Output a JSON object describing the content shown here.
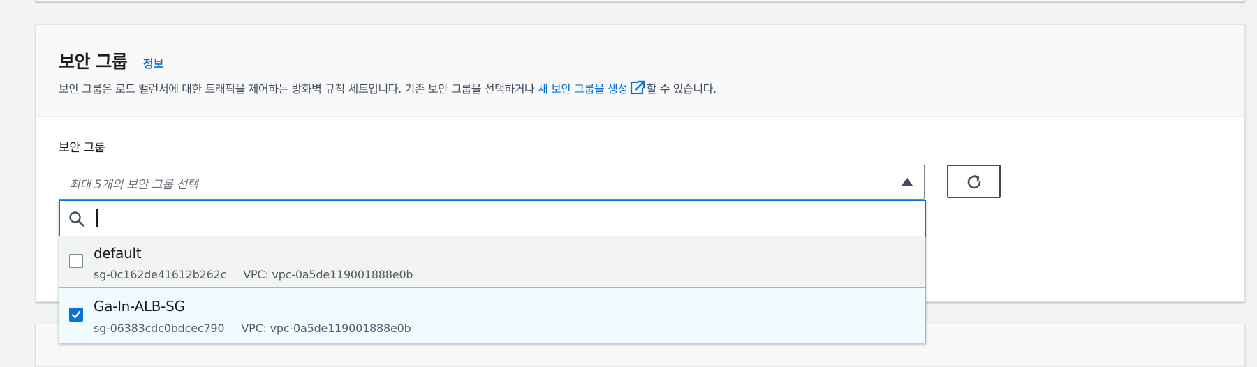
{
  "section": {
    "title": "보안 그룹",
    "info_link": "정보",
    "description_prefix": "보안 그룹은 로드 밸런서에 대한 트래픽을 제어하는 방화벽 규칙 세트입니다. 기존 보안 그룹을 선택하거나 ",
    "description_link": "새 보안 그룹을 생성",
    "description_suffix": "할 수 있습니다.",
    "link_icon": "external-link-icon"
  },
  "field": {
    "label": "보안 그룹",
    "placeholder": "최대 5개의 보안 그룹 선택",
    "search_value": ""
  },
  "refresh_icon": "refresh-icon",
  "options": [
    {
      "name": "default",
      "id": "sg-0c162de41612b262c",
      "vpc": "VPC: vpc-0a5de119001888e0b",
      "checked": false
    },
    {
      "name": "Ga-In-ALB-SG",
      "id": "sg-06383cdc0bdcec790",
      "vpc": "VPC: vpc-0a5de119001888e0b",
      "checked": true
    }
  ],
  "colors": {
    "link": "#0972d3",
    "selected_bg": "#f1faff",
    "hover_bg": "#f2f3f3",
    "focus_border": "#0972d3"
  }
}
